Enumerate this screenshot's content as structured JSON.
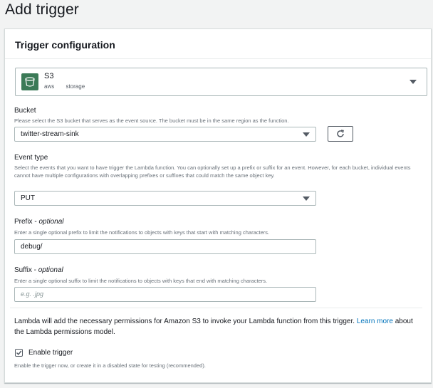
{
  "page": {
    "title": "Add trigger"
  },
  "panel": {
    "title": "Trigger configuration"
  },
  "service": {
    "name": "S3",
    "tags": [
      "aws",
      "storage"
    ],
    "icon": "s3-bucket-icon",
    "icon_color": "#3b7a57"
  },
  "bucket": {
    "label": "Bucket",
    "description": "Please select the S3 bucket that serves as the event source. The bucket must be in the same region as the function.",
    "value": "twitter-stream-sink"
  },
  "event_type": {
    "label": "Event type",
    "description": "Select the events that you want to have trigger the Lambda function. You can optionally set up a prefix or suffix for an event. However, for each bucket, individual events cannot have multiple configurations with overlapping prefixes or suffixes that could match the same object key.",
    "value": "PUT"
  },
  "prefix": {
    "label": "Prefix",
    "optional": "optional",
    "description": "Enter a single optional prefix to limit the notifications to objects with keys that start with matching characters.",
    "value": "debug/"
  },
  "suffix": {
    "label": "Suffix",
    "optional": "optional",
    "description": "Enter a single optional suffix to limit the notifications to objects with keys that end with matching characters.",
    "placeholder": "e.g. .jpg"
  },
  "permissions": {
    "text": "Lambda will add the necessary permissions for Amazon S3 to invoke your Lambda function from this trigger.",
    "link_text": "Learn more",
    "link_suffix": "about the Lambda permissions model."
  },
  "enable_trigger": {
    "label": "Enable trigger",
    "checked": true,
    "description": "Enable the trigger now, or create it in a disabled state for testing (recommended)."
  },
  "colors": {
    "link": "#0073bb",
    "text": "#16191f",
    "muted": "#687078"
  }
}
